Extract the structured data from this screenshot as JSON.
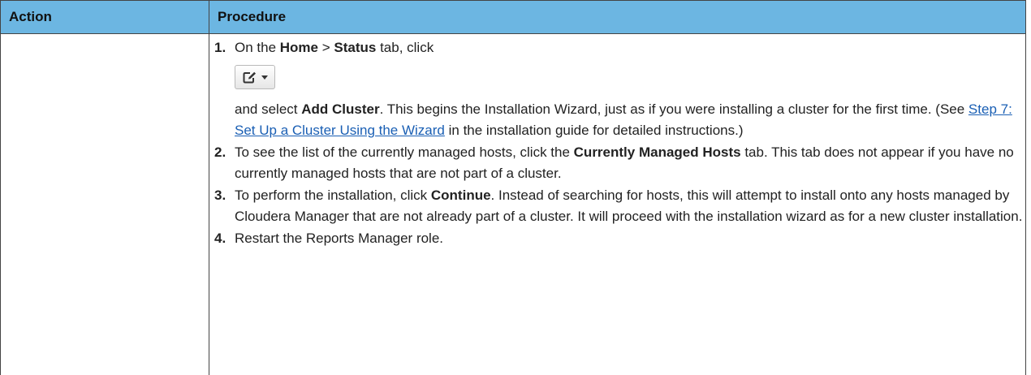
{
  "table": {
    "headers": {
      "action": "Action",
      "procedure": "Procedure"
    },
    "steps": [
      {
        "number": "1.",
        "line1_text1": "On the ",
        "line1_bold1": "Home",
        "line1_text2": " > ",
        "line1_bold2": "Status",
        "line1_text3": " tab, click",
        "button_icon": "edit-dropdown-icon",
        "text_after_button": "and select ",
        "bold_add_cluster": "Add Cluster",
        "text_main": ". This begins the Installation Wizard, just as if you were installing a cluster for the first time. (See ",
        "link_text": "Step 7: Set Up a Cluster Using the Wizard",
        "text_end": " in the installation guide for detailed instructions.)"
      },
      {
        "number": "2.",
        "text1": "To see the list of the currently managed hosts, click the ",
        "bold": "Currently Managed Hosts",
        "text2": " tab. This tab does not appear if you have no currently managed hosts that are not part of a cluster."
      },
      {
        "number": "3.",
        "text1": "To perform the installation, click ",
        "bold": "Continue",
        "text2": ". Instead of searching for hosts, this will attempt to install onto any hosts managed by Cloudera Manager that are not already part of a cluster. It will proceed with the installation wizard as for a new cluster installation."
      },
      {
        "number": "4.",
        "text": "Restart the Reports Manager role."
      }
    ]
  },
  "colors": {
    "header_bg": "#6cb6e2",
    "link": "#1a5fb4",
    "border": "#444444"
  }
}
